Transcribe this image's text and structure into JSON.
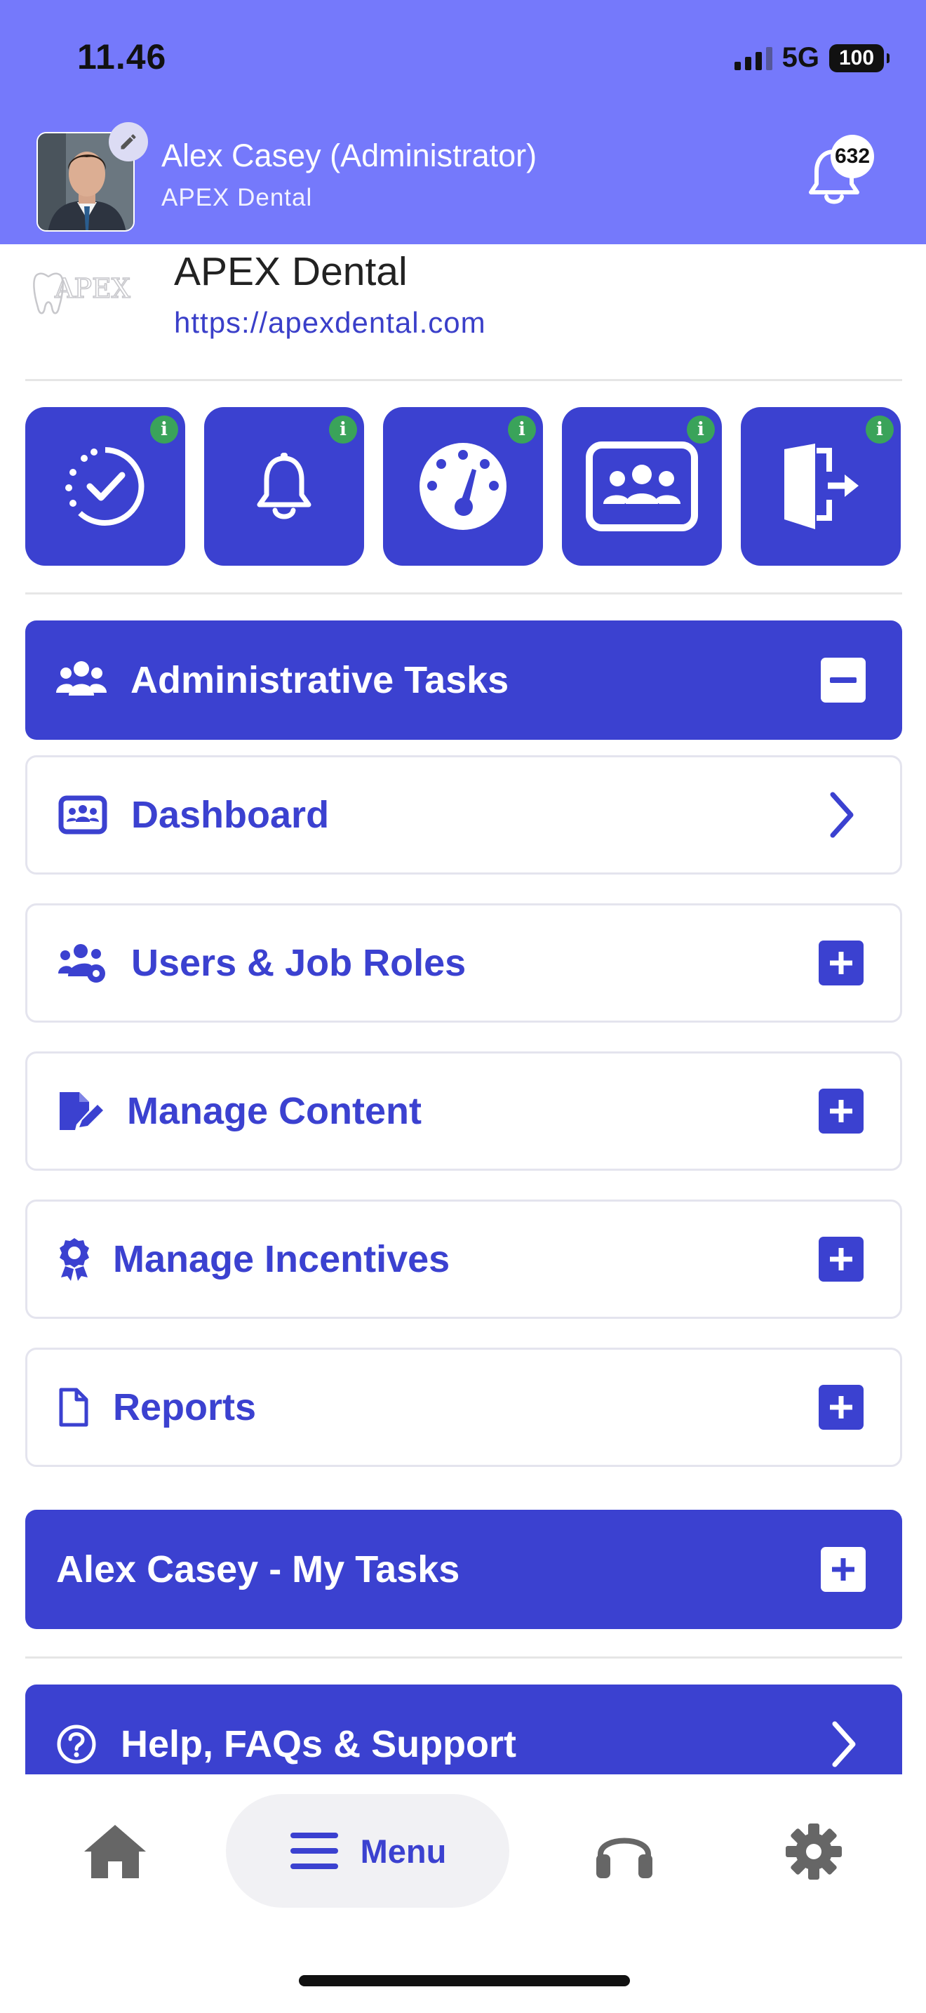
{
  "status_bar": {
    "time": "11.46",
    "network": "5G",
    "battery": "100"
  },
  "header": {
    "user_name": "Alex Casey (Administrator)",
    "organization": "APEX Dental",
    "notification_count": "632"
  },
  "org": {
    "logo_text": "APEX",
    "name": "APEX Dental",
    "url": "https://apexdental.com"
  },
  "quick_actions": [
    {
      "icon": "progress-check-icon",
      "info": "i"
    },
    {
      "icon": "bell-icon",
      "info": "i"
    },
    {
      "icon": "gauge-icon",
      "info": "i"
    },
    {
      "icon": "team-board-icon",
      "info": "i"
    },
    {
      "icon": "logout-door-icon",
      "info": "i"
    }
  ],
  "sections": {
    "admin_tasks": "Administrative Tasks",
    "dashboard": "Dashboard",
    "users_roles": "Users & Job Roles",
    "manage_content": "Manage Content",
    "manage_incentives": "Manage Incentives",
    "reports": "Reports",
    "my_tasks": "Alex Casey - My Tasks",
    "help": "Help, FAQs & Support"
  },
  "bottom_nav": {
    "menu_label": "Menu"
  },
  "colors": {
    "header_bg": "#7579fb",
    "primary": "#3b41d0",
    "info_badge": "#3aa35a"
  }
}
